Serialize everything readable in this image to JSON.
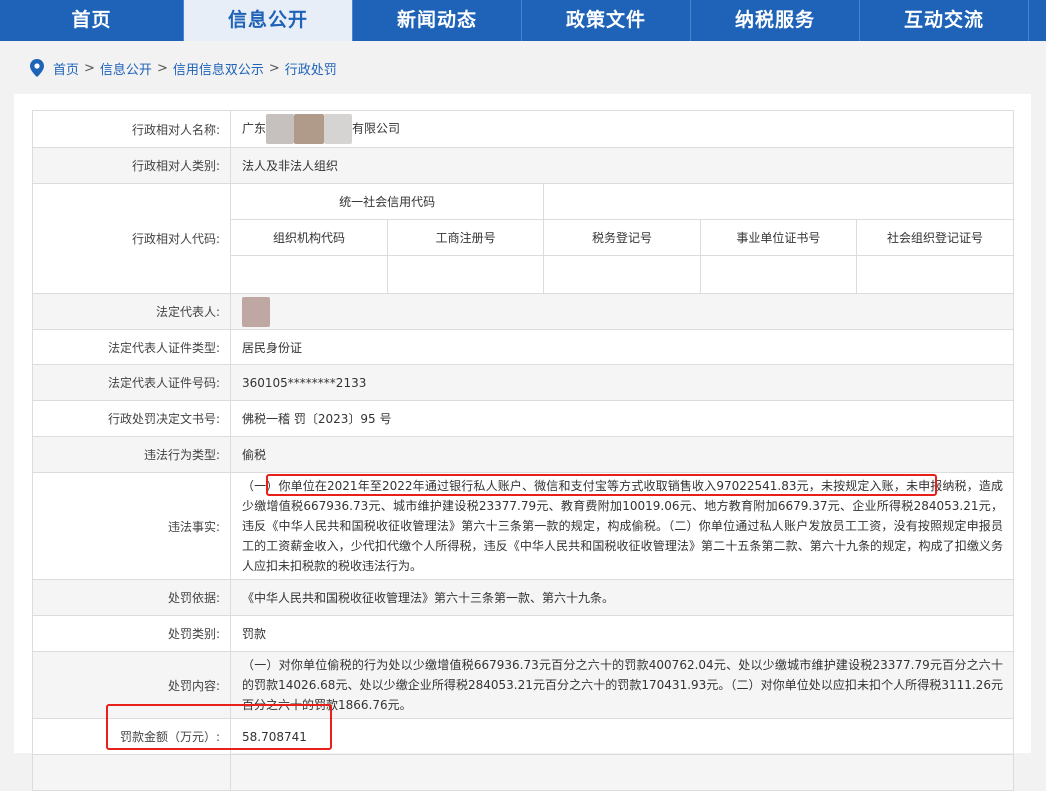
{
  "nav": {
    "items": [
      {
        "label": "首页",
        "active": false
      },
      {
        "label": "信息公开",
        "active": true
      },
      {
        "label": "新闻动态",
        "active": false
      },
      {
        "label": "政策文件",
        "active": false
      },
      {
        "label": "纳税服务",
        "active": false
      },
      {
        "label": "互动交流",
        "active": false
      }
    ]
  },
  "breadcrumb": {
    "icon": "location-pin-icon",
    "items": [
      "首页",
      "信息公开",
      "信用信息双公示",
      "行政处罚"
    ],
    "separator": ">"
  },
  "record": {
    "name_label": "行政相对人名称:",
    "name_prefix": "广东",
    "name_suffix": "有限公司",
    "type_label": "行政相对人类别:",
    "type_value": "法人及非法人组织",
    "code_label": "行政相对人代码:",
    "code_headers": {
      "uscc": "统一社会信用代码",
      "org": "组织机构代码",
      "biz": "工商注册号",
      "tax": "税务登记号",
      "inst": "事业单位证书号",
      "soc": "社会组织登记证号"
    },
    "legal_rep_label": "法定代表人:",
    "id_type_label": "法定代表人证件类型:",
    "id_type_value": "居民身份证",
    "id_no_label": "法定代表人证件号码:",
    "id_no_value": "360105********2133",
    "doc_no_label": "行政处罚决定文书号:",
    "doc_no_value": "佛税一稽 罚〔2023〕95 号",
    "violation_type_label": "违法行为类型:",
    "violation_type_value": "偷税",
    "facts_label": "违法事实:",
    "facts_value": "（一）你单位在2021年至2022年通过银行私人账户、微信和支付宝等方式收取销售收入97022541.83元，未按规定入账，未申报纳税，造成少缴增值税667936.73元、城市维护建设税23377.79元、教育费附加10019.06元、地方教育附加6679.37元、企业所得税284053.21元，违反《中华人民共和国税收征收管理法》第六十三条第一款的规定，构成偷税。（二）你单位通过私人账户发放员工工资，没有按照规定申报员工的工资薪金收入，少代扣代缴个人所得税，违反《中华人民共和国税收征收管理法》第二十五条第二款、第六十九条的规定，构成了扣缴义务人应扣未扣税款的税收违法行为。",
    "basis_label": "处罚依据:",
    "basis_value": "《中华人民共和国税收征收管理法》第六十三条第一款、第六十九条。",
    "penalty_type_label": "处罚类别:",
    "penalty_type_value": "罚款",
    "content_label": "处罚内容:",
    "content_value": "（一）对你单位偷税的行为处以少缴增值税667936.73元百分之六十的罚款400762.04元、处以少缴城市维护建设税23377.79元百分之六十的罚款14026.68元、处以少缴企业所得税284053.21元百分之六十的罚款170431.93元。（二）对你单位处以应扣未扣个人所得税3111.26元百分之六十的罚款1866.76元。",
    "fine_label": "罚款金额（万元）:",
    "fine_value": "58.708741"
  },
  "colors": {
    "nav_bg": "#1e63b8",
    "nav_active_bg": "#e8eef7",
    "highlight_box": "#e8201a"
  }
}
